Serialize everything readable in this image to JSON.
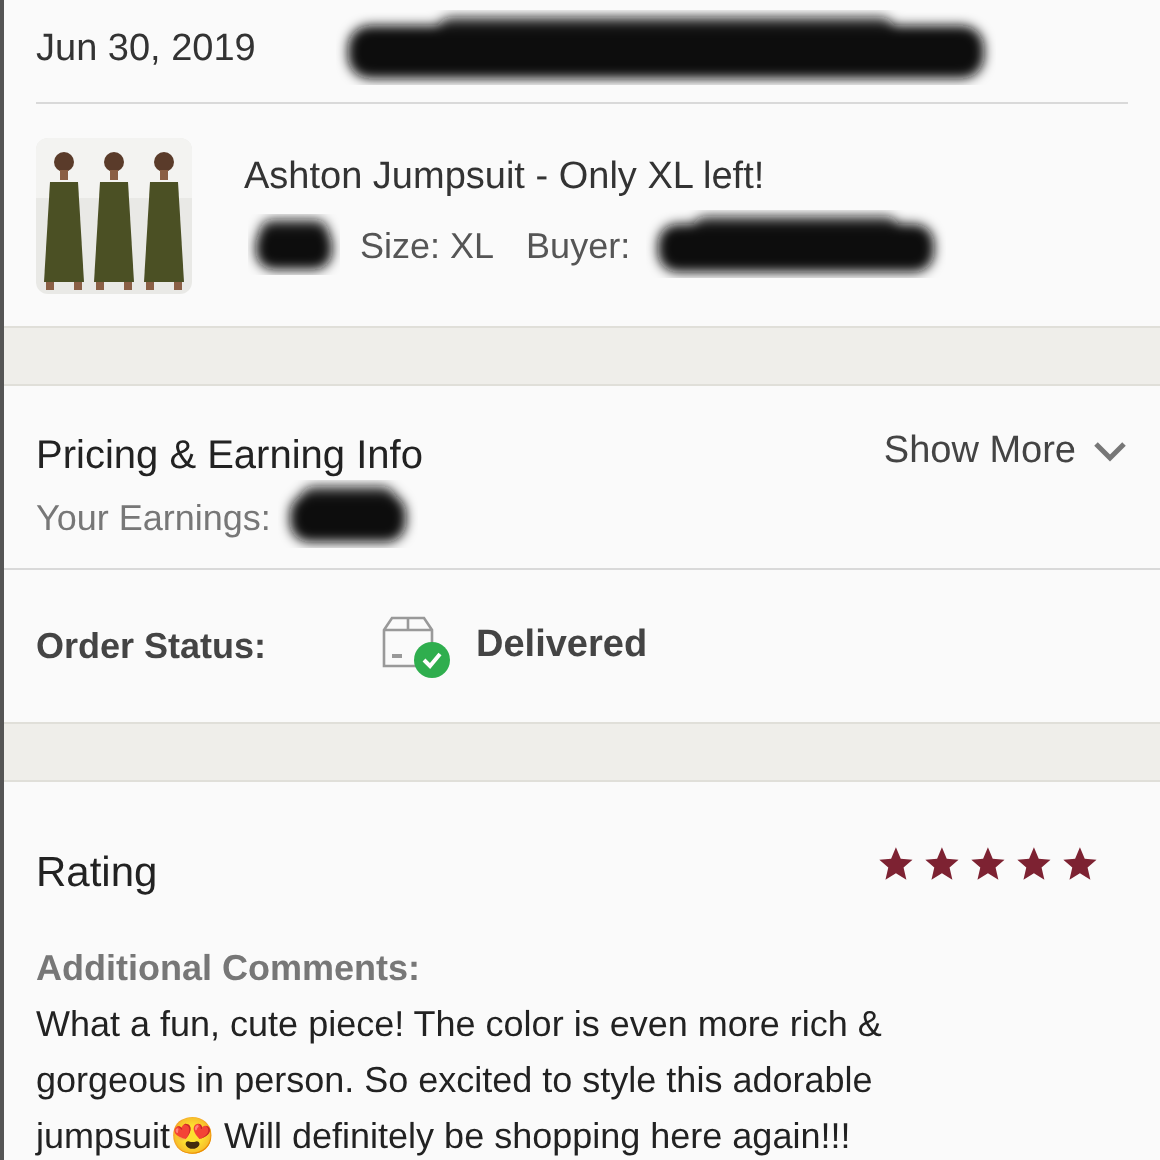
{
  "order": {
    "date": "Jun 30, 2019",
    "id_redacted": true
  },
  "item": {
    "title": "Ashton Jumpsuit - Only XL left!",
    "price_redacted": true,
    "size": "Size: XL",
    "buyer_label": "Buyer:",
    "buyer_redacted": true
  },
  "pricing": {
    "title": "Pricing & Earning Info",
    "earnings_label": "Your Earnings:",
    "earnings_redacted": true,
    "show_more": "Show More",
    "expanded": false
  },
  "status": {
    "label": "Order Status:",
    "value": "Delivered",
    "delivered": true
  },
  "rating": {
    "title": "Rating",
    "stars": 5,
    "comments_label": "Additional Comments:",
    "comment": "What a fun, cute piece! The color is even more rich & gorgeous in person. So excited to style this adorable jumpsuit😍 Will definitely be shopping here again!!!"
  }
}
